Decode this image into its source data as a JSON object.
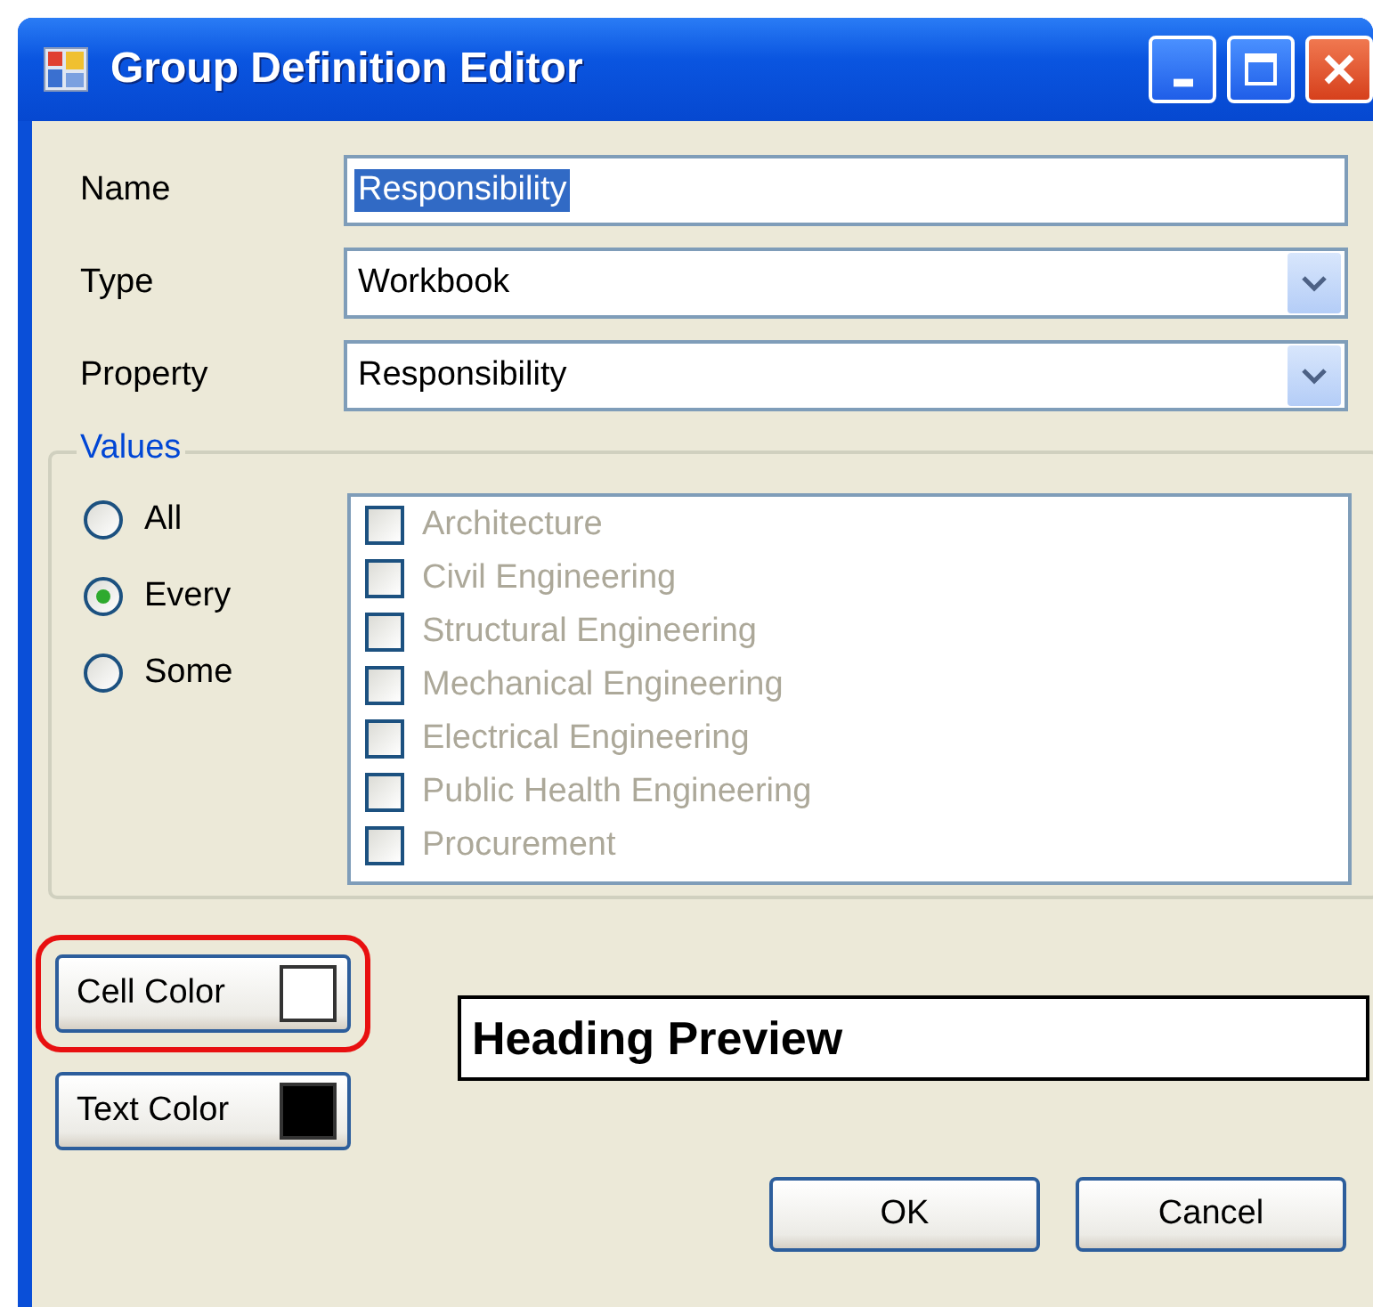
{
  "window": {
    "title": "Group Definition Editor"
  },
  "fields": [
    {
      "label": "Name",
      "kind": "text",
      "value": "Responsibility",
      "selected": true
    },
    {
      "label": "Type",
      "kind": "dropdown",
      "value": "Workbook"
    },
    {
      "label": "Property",
      "kind": "dropdown",
      "value": "Responsibility"
    }
  ],
  "values_group": {
    "title": "Values",
    "radios": [
      {
        "label": "All",
        "selected": false
      },
      {
        "label": "Every",
        "selected": true
      },
      {
        "label": "Some",
        "selected": false
      }
    ],
    "list": {
      "disabled": true,
      "items": [
        {
          "label": "Architecture",
          "checked": false
        },
        {
          "label": "Civil Engineering",
          "checked": false
        },
        {
          "label": "Structural Engineering",
          "checked": false
        },
        {
          "label": "Mechanical Engineering",
          "checked": false
        },
        {
          "label": "Electrical Engineering",
          "checked": false
        },
        {
          "label": "Public Health Engineering",
          "checked": false
        },
        {
          "label": "Procurement",
          "checked": false
        }
      ]
    }
  },
  "color_buttons": [
    {
      "label": "Cell Color",
      "color": "#ffffff",
      "highlighted": true
    },
    {
      "label": "Text Color",
      "color": "#000000",
      "highlighted": false
    }
  ],
  "preview": {
    "text": "Heading Preview"
  },
  "buttons": [
    "OK",
    "Cancel"
  ]
}
